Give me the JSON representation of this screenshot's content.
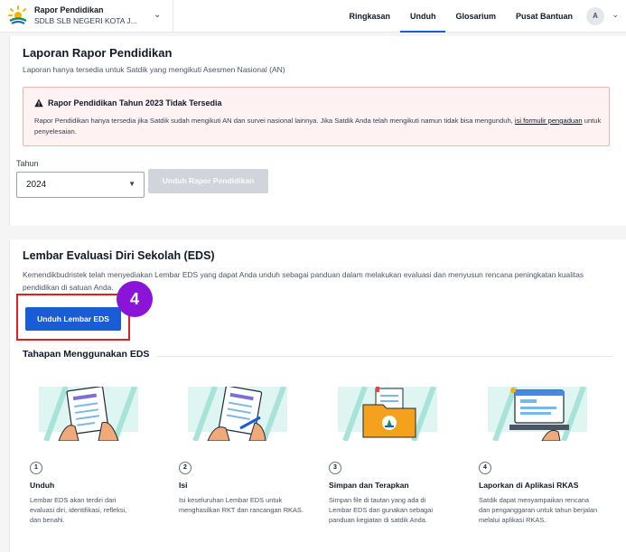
{
  "topbar": {
    "brand_title": "Rapor Pendidikan",
    "brand_school": "SDLB SLB NEGERI KOTA J...",
    "nav": [
      "Ringkasan",
      "Unduh",
      "Glosarium",
      "Pusat Bantuan"
    ],
    "active_nav": "Unduh",
    "avatar_initial": "A"
  },
  "laporan": {
    "title": "Laporan Rapor Pendidikan",
    "subtitle": "Laporan hanya tersedia untuk Satdik yang mengikuti Asesmen Nasional (AN)",
    "alert_title": "Rapor Pendidikan Tahun 2023 Tidak Tersedia",
    "alert_body": "Rapor Pendidikan hanya tersedia jika Satdik sudah mengikuti AN dan survei nasional lainnya. Jika Satdik Anda telah mengikuti namun tidak bisa mengunduh, ",
    "alert_link": "isi formulir pengaduan",
    "alert_tail": " untuk penyelesaian.",
    "year_label": "Tahun",
    "year_value": "2024",
    "download_button": "Unduh Rapor Pendidikan"
  },
  "eds": {
    "title": "Lembar Evaluasi Diri Sekolah (EDS)",
    "description": "Kemendikbudristek telah menyediakan Lembar EDS yang dapat Anda unduh sebagai panduan dalam melakukan evaluasi dan menyusun rencana peningkatan kualitas pendidikan di satuan Anda.",
    "download_button": "Unduh Lembar EDS",
    "step_badge": "4",
    "tahapan_title": "Tahapan Menggunakan EDS",
    "steps": [
      {
        "num": "1",
        "title": "Unduh",
        "desc": "Lembar EDS akan terdiri dari evaluasi diri, identifikasi, refleksi, dan benahi."
      },
      {
        "num": "2",
        "title": "Isi",
        "desc": "Isi keseluruhan Lembar EDS untuk menghasilkan RKT dan rancangan RKAS."
      },
      {
        "num": "3",
        "title": "Simpan dan Terapkan",
        "desc": "Simpan file di tautan yang ada di Lembar EDS dan gunakan sebagai panduan kegiatan di satdik Anda."
      },
      {
        "num": "4",
        "title": "Laporkan di Aplikasi RKAS",
        "desc": "Satdik dapat menyampaikan rencana dan penganggaran untuk tahun berjalan melalui aplikasi RKAS."
      }
    ]
  },
  "colors": {
    "primary": "#1a5bd6",
    "badge": "#8a14d8",
    "highlight": "#e02020",
    "alert_bg": "#fef2f2"
  }
}
